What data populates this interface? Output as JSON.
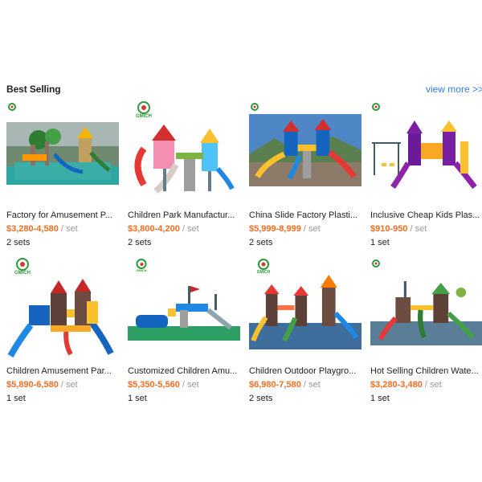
{
  "section": {
    "title": "Best Selling",
    "view_more": "view more >>"
  },
  "logo_text": "GMICH",
  "products": [
    {
      "name": "Factory for Amusement P...",
      "price": "$3,280-4,580",
      "unit": " / set",
      "qty": "2 sets",
      "logo": "small"
    },
    {
      "name": "Children Park Manufactur...",
      "price": "$3,800-4,200",
      "unit": " / set",
      "qty": "2 sets",
      "logo": "large"
    },
    {
      "name": "China Slide Factory Plasti...",
      "price": "$5,999-8,999",
      "unit": " / set",
      "qty": "2 sets",
      "logo": "small"
    },
    {
      "name": "Inclusive Cheap Kids Plas...",
      "price": "$910-950",
      "unit": " / set",
      "qty": "1 set",
      "logo": "small"
    },
    {
      "name": "Children Amusement Par...",
      "price": "$5,890-6,580",
      "unit": " / set",
      "qty": "1 set",
      "logo": "large"
    },
    {
      "name": "Customized Children Amu...",
      "price": "$5,350-5,560",
      "unit": " / set",
      "qty": "1 set",
      "logo": "medium"
    },
    {
      "name": "Children Outdoor Playgro...",
      "price": "$6,980-7,580",
      "unit": " / set",
      "qty": "2 sets",
      "logo": "medium"
    },
    {
      "name": "Hot Selling Children Wate...",
      "price": "$3,280-3,480",
      "unit": " / set",
      "qty": "1 set",
      "logo": "small"
    }
  ]
}
